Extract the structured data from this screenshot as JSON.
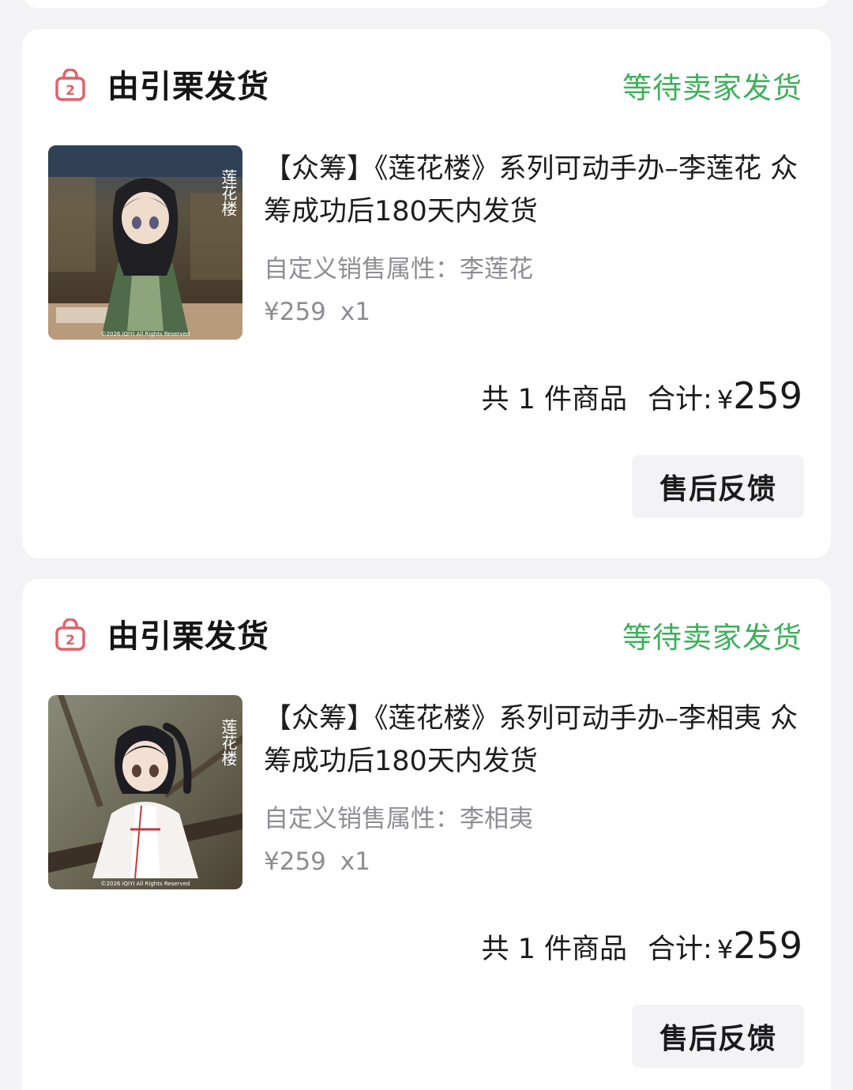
{
  "orders": [
    {
      "shop_name": "由引栗发货",
      "status": "等待卖家发货",
      "title": "【众筹】《莲花楼》系列可动手办–李莲花 众筹成功后180天内发货",
      "attribute": "自定义销售属性：李莲花",
      "price": "¥259",
      "quantity": "x1",
      "count_text": "共 1 件商品",
      "sum_label": "合计:",
      "currency": "¥",
      "total": "259",
      "aftersale_label": "售后反馈",
      "thumb_caption": "©2026 iQIYI All Rights Reserved",
      "thumb_logo": "莲花楼"
    },
    {
      "shop_name": "由引栗发货",
      "status": "等待卖家发货",
      "title": "【众筹】《莲花楼》系列可动手办–李相夷 众筹成功后180天内发货",
      "attribute": "自定义销售属性：李相夷",
      "price": "¥259",
      "quantity": "x1",
      "count_text": "共 1 件商品",
      "sum_label": "合计:",
      "currency": "¥",
      "total": "259",
      "aftersale_label": "售后反馈",
      "thumb_caption": "©2026 iQIYI All Rights Reserved",
      "thumb_logo": "莲花楼"
    }
  ],
  "colors": {
    "status_green": "#3db05a",
    "icon_red": "#e0626a"
  },
  "icons": {
    "shop": "shopping-bag-icon"
  }
}
